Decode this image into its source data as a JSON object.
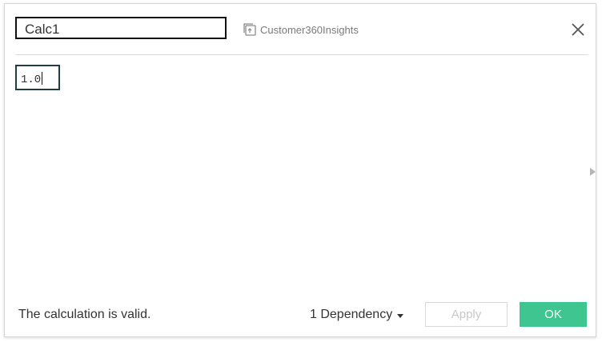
{
  "header": {
    "calc_name": "Calc1",
    "datasource_name": "Customer360Insights",
    "datasource_icon": "datasource-icon",
    "close_icon": "close-icon"
  },
  "editor": {
    "formula": "1.0",
    "expand_icon": "expand-arrow-icon"
  },
  "footer": {
    "status_text": "The calculation is valid.",
    "dependency_label": "1 Dependency",
    "apply_label": "Apply",
    "ok_label": "OK"
  },
  "colors": {
    "ok_button": "#3ec590",
    "formula_border": "#1f3d42"
  }
}
